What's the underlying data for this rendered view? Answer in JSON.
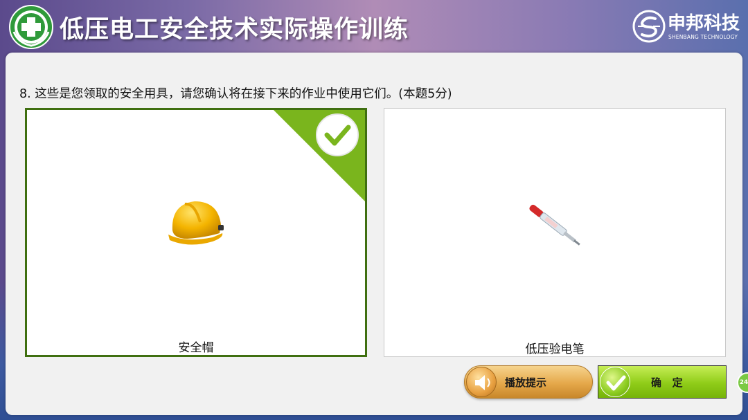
{
  "header": {
    "logo_icon": "safety-cross-emblem-icon",
    "title": "低压电工安全技术实际操作训练",
    "brand": {
      "icon": "brand-s-logo-icon",
      "name": "申邦科技",
      "subtitle": "SHENBANG TECHNOLOGY"
    }
  },
  "question": {
    "text": "8. 这些是您领取的安全用具，请您确认将在接下来的作业中使用它们。(本题5分)"
  },
  "options": [
    {
      "label": "安全帽",
      "image": "yellow-safety-helmet",
      "selected": true
    },
    {
      "label": "低压验电笔",
      "image": "voltage-tester-pen",
      "selected": false
    }
  ],
  "buttons": {
    "hint": {
      "label": "播放提示",
      "icon": "speaker-icon"
    },
    "confirm": {
      "label": "确   定",
      "icon": "check-icon"
    }
  },
  "side_badge": {
    "text": "24"
  },
  "colors": {
    "selected_border": "#3f6f10",
    "check_green": "#7ab51d",
    "confirm_green": "#8fcc18",
    "hint_orange": "#e5a84a"
  }
}
